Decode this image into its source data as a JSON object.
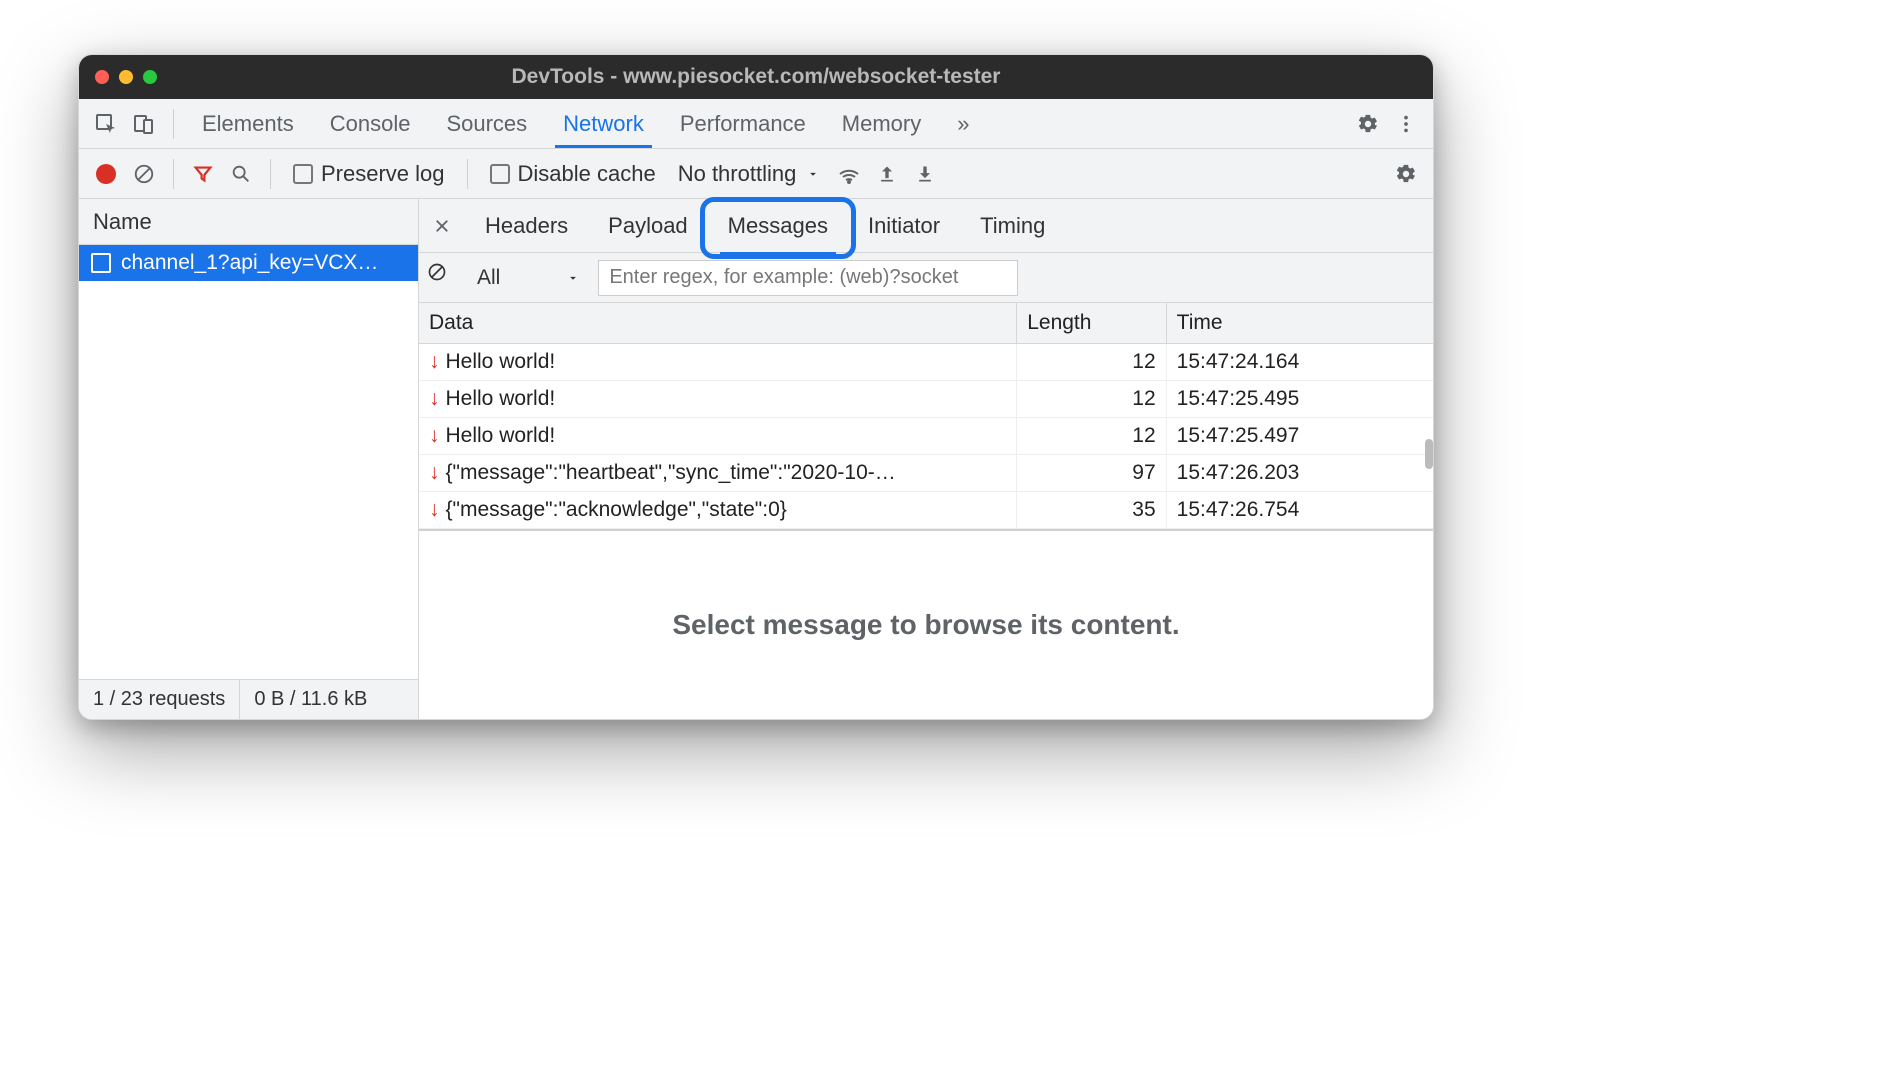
{
  "window": {
    "title": "DevTools - www.piesocket.com/websocket-tester"
  },
  "tabs": {
    "items": [
      "Elements",
      "Console",
      "Sources",
      "Network",
      "Performance",
      "Memory"
    ],
    "more": "»",
    "active": "Network"
  },
  "toolbar": {
    "preserve_log": "Preserve log",
    "disable_cache": "Disable cache",
    "throttling": "No throttling"
  },
  "sidebar": {
    "header": "Name",
    "selected_request": "channel_1?api_key=VCX…"
  },
  "status": {
    "requests": "1 / 23 requests",
    "transfer": "0 B / 11.6 kB"
  },
  "detail": {
    "tabs": [
      "Headers",
      "Payload",
      "Messages",
      "Initiator",
      "Timing"
    ],
    "active": "Messages",
    "filter_all": "All",
    "regex_placeholder": "Enter regex, for example: (web)?socket",
    "columns": {
      "data": "Data",
      "length": "Length",
      "time": "Time"
    },
    "messages": [
      {
        "dir": "down",
        "data": "Hello world!",
        "length": "12",
        "time": "15:47:24.164"
      },
      {
        "dir": "down",
        "data": "Hello world!",
        "length": "12",
        "time": "15:47:25.495"
      },
      {
        "dir": "down",
        "data": "Hello world!",
        "length": "12",
        "time": "15:47:25.497"
      },
      {
        "dir": "down",
        "data": "{\"message\":\"heartbeat\",\"sync_time\":\"2020-10-…",
        "length": "97",
        "time": "15:47:26.203"
      },
      {
        "dir": "down",
        "data": "{\"message\":\"acknowledge\",\"state\":0}",
        "length": "35",
        "time": "15:47:26.754"
      }
    ],
    "placeholder": "Select message to browse its content."
  }
}
